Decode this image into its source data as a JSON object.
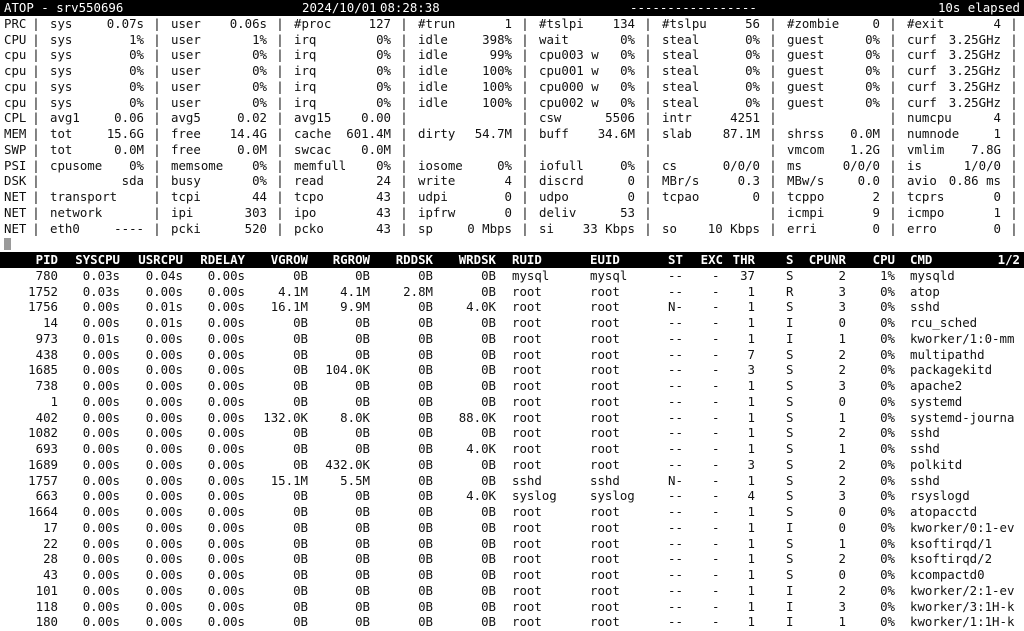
{
  "header": {
    "title": "ATOP - srv550696",
    "date": "2024/10/01",
    "time": "08:28:38",
    "dashes": "-----------------",
    "elapsed": "10s elapsed"
  },
  "system_rows": [
    {
      "label": "PRC",
      "cells": [
        [
          "sys",
          "0.07s"
        ],
        [
          "user",
          "0.06s"
        ],
        [
          "#proc",
          "127"
        ],
        [
          "#trun",
          "1"
        ],
        [
          "#tslpi",
          "134"
        ],
        [
          "#tslpu",
          "56"
        ],
        [
          "#zombie",
          "0"
        ],
        [
          "#exit",
          "4"
        ]
      ]
    },
    {
      "label": "CPU",
      "cells": [
        [
          "sys",
          "1%"
        ],
        [
          "user",
          "1%"
        ],
        [
          "irq",
          "0%"
        ],
        [
          "idle",
          "398%"
        ],
        [
          "wait",
          "0%"
        ],
        [
          "steal",
          "0%"
        ],
        [
          "guest",
          "0%"
        ],
        [
          "curf",
          "3.25GHz"
        ]
      ]
    },
    {
      "label": "cpu",
      "cells": [
        [
          "sys",
          "0%"
        ],
        [
          "user",
          "0%"
        ],
        [
          "irq",
          "0%"
        ],
        [
          "idle",
          "99%"
        ],
        [
          "cpu003 w",
          "0%"
        ],
        [
          "steal",
          "0%"
        ],
        [
          "guest",
          "0%"
        ],
        [
          "curf",
          "3.25GHz"
        ]
      ]
    },
    {
      "label": "cpu",
      "cells": [
        [
          "sys",
          "0%"
        ],
        [
          "user",
          "0%"
        ],
        [
          "irq",
          "0%"
        ],
        [
          "idle",
          "100%"
        ],
        [
          "cpu001 w",
          "0%"
        ],
        [
          "steal",
          "0%"
        ],
        [
          "guest",
          "0%"
        ],
        [
          "curf",
          "3.25GHz"
        ]
      ]
    },
    {
      "label": "cpu",
      "cells": [
        [
          "sys",
          "0%"
        ],
        [
          "user",
          "0%"
        ],
        [
          "irq",
          "0%"
        ],
        [
          "idle",
          "100%"
        ],
        [
          "cpu000 w",
          "0%"
        ],
        [
          "steal",
          "0%"
        ],
        [
          "guest",
          "0%"
        ],
        [
          "curf",
          "3.25GHz"
        ]
      ]
    },
    {
      "label": "cpu",
      "cells": [
        [
          "sys",
          "0%"
        ],
        [
          "user",
          "0%"
        ],
        [
          "irq",
          "0%"
        ],
        [
          "idle",
          "100%"
        ],
        [
          "cpu002 w",
          "0%"
        ],
        [
          "steal",
          "0%"
        ],
        [
          "guest",
          "0%"
        ],
        [
          "curf",
          "3.25GHz"
        ]
      ]
    },
    {
      "label": "CPL",
      "cells": [
        [
          "avg1",
          "0.06"
        ],
        [
          "avg5",
          "0.02"
        ],
        [
          "avg15",
          "0.00"
        ],
        [
          "",
          ""
        ],
        [
          "csw",
          "5506"
        ],
        [
          "intr",
          "4251"
        ],
        [
          "",
          ""
        ],
        [
          "numcpu",
          "4"
        ]
      ]
    },
    {
      "label": "MEM",
      "cells": [
        [
          "tot",
          "15.6G"
        ],
        [
          "free",
          "14.4G"
        ],
        [
          "cache",
          "601.4M"
        ],
        [
          "dirty",
          "54.7M"
        ],
        [
          "buff",
          "34.6M"
        ],
        [
          "slab",
          "87.1M"
        ],
        [
          "shrss",
          "0.0M"
        ],
        [
          "numnode",
          "1"
        ]
      ]
    },
    {
      "label": "SWP",
      "cells": [
        [
          "tot",
          "0.0M"
        ],
        [
          "free",
          "0.0M"
        ],
        [
          "swcac",
          "0.0M"
        ],
        [
          "",
          ""
        ],
        [
          "",
          ""
        ],
        [
          "",
          ""
        ],
        [
          "vmcom",
          "1.2G"
        ],
        [
          "vmlim",
          "7.8G"
        ]
      ]
    },
    {
      "label": "PSI",
      "cells": [
        [
          "cpusome",
          "0%"
        ],
        [
          "memsome",
          "0%"
        ],
        [
          "memfull",
          "0%"
        ],
        [
          "iosome",
          "0%"
        ],
        [
          "iofull",
          "0%"
        ],
        [
          "cs",
          "0/0/0"
        ],
        [
          "ms",
          "0/0/0"
        ],
        [
          "is",
          "1/0/0"
        ]
      ]
    },
    {
      "label": "DSK",
      "cells": [
        [
          "",
          "sda"
        ],
        [
          "busy",
          "0%"
        ],
        [
          "read",
          "24"
        ],
        [
          "write",
          "4"
        ],
        [
          "discrd",
          "0"
        ],
        [
          "MBr/s",
          "0.3"
        ],
        [
          "MBw/s",
          "0.0"
        ],
        [
          "avio",
          "0.86 ms"
        ]
      ]
    },
    {
      "label": "NET",
      "cells": [
        [
          "transport",
          ""
        ],
        [
          "tcpi",
          "44"
        ],
        [
          "tcpo",
          "43"
        ],
        [
          "udpi",
          "0"
        ],
        [
          "udpo",
          "0"
        ],
        [
          "tcpao",
          "0"
        ],
        [
          "tcppo",
          "2"
        ],
        [
          "tcprs",
          "0"
        ]
      ]
    },
    {
      "label": "NET",
      "cells": [
        [
          "network",
          ""
        ],
        [
          "ipi",
          "303"
        ],
        [
          "ipo",
          "43"
        ],
        [
          "ipfrw",
          "0"
        ],
        [
          "deliv",
          "53"
        ],
        [
          "",
          ""
        ],
        [
          "icmpi",
          "9"
        ],
        [
          "icmpo",
          "1"
        ]
      ]
    },
    {
      "label": "NET",
      "cells": [
        [
          "eth0",
          "----"
        ],
        [
          "pcki",
          "520"
        ],
        [
          "pcko",
          "43"
        ],
        [
          "sp",
          "0 Mbps"
        ],
        [
          "si",
          "33 Kbps"
        ],
        [
          "so",
          "10 Kbps"
        ],
        [
          "erri",
          "0"
        ],
        [
          "erro",
          "0"
        ]
      ]
    }
  ],
  "process_table": {
    "columns": [
      "PID",
      "SYSCPU",
      "USRCPU",
      "RDELAY",
      "VGROW",
      "RGROW",
      "RDDSK",
      "WRDSK",
      "RUID",
      "EUID",
      "ST",
      "EXC",
      "THR",
      "S",
      "CPUNR",
      "CPU",
      "CMD"
    ],
    "page": "1/2",
    "rows": [
      [
        "780",
        "0.03s",
        "0.04s",
        "0.00s",
        "0B",
        "0B",
        "0B",
        "0B",
        "mysql",
        "mysql",
        "--",
        "-",
        "37",
        "S",
        "2",
        "1%",
        "mysqld"
      ],
      [
        "1752",
        "0.03s",
        "0.00s",
        "0.00s",
        "4.1M",
        "4.1M",
        "2.8M",
        "0B",
        "root",
        "root",
        "--",
        "-",
        "1",
        "R",
        "3",
        "0%",
        "atop"
      ],
      [
        "1756",
        "0.00s",
        "0.01s",
        "0.00s",
        "16.1M",
        "9.9M",
        "0B",
        "4.0K",
        "root",
        "root",
        "N-",
        "-",
        "1",
        "S",
        "3",
        "0%",
        "sshd"
      ],
      [
        "14",
        "0.00s",
        "0.01s",
        "0.00s",
        "0B",
        "0B",
        "0B",
        "0B",
        "root",
        "root",
        "--",
        "-",
        "1",
        "I",
        "0",
        "0%",
        "rcu_sched"
      ],
      [
        "973",
        "0.01s",
        "0.00s",
        "0.00s",
        "0B",
        "0B",
        "0B",
        "0B",
        "root",
        "root",
        "--",
        "-",
        "1",
        "I",
        "1",
        "0%",
        "kworker/1:0-mm"
      ],
      [
        "438",
        "0.00s",
        "0.00s",
        "0.00s",
        "0B",
        "0B",
        "0B",
        "0B",
        "root",
        "root",
        "--",
        "-",
        "7",
        "S",
        "2",
        "0%",
        "multipathd"
      ],
      [
        "1685",
        "0.00s",
        "0.00s",
        "0.00s",
        "0B",
        "104.0K",
        "0B",
        "0B",
        "root",
        "root",
        "--",
        "-",
        "3",
        "S",
        "2",
        "0%",
        "packagekitd"
      ],
      [
        "738",
        "0.00s",
        "0.00s",
        "0.00s",
        "0B",
        "0B",
        "0B",
        "0B",
        "root",
        "root",
        "--",
        "-",
        "1",
        "S",
        "3",
        "0%",
        "apache2"
      ],
      [
        "1",
        "0.00s",
        "0.00s",
        "0.00s",
        "0B",
        "0B",
        "0B",
        "0B",
        "root",
        "root",
        "--",
        "-",
        "1",
        "S",
        "0",
        "0%",
        "systemd"
      ],
      [
        "402",
        "0.00s",
        "0.00s",
        "0.00s",
        "132.0K",
        "8.0K",
        "0B",
        "88.0K",
        "root",
        "root",
        "--",
        "-",
        "1",
        "S",
        "1",
        "0%",
        "systemd-journa"
      ],
      [
        "1082",
        "0.00s",
        "0.00s",
        "0.00s",
        "0B",
        "0B",
        "0B",
        "0B",
        "root",
        "root",
        "--",
        "-",
        "1",
        "S",
        "2",
        "0%",
        "sshd"
      ],
      [
        "693",
        "0.00s",
        "0.00s",
        "0.00s",
        "0B",
        "0B",
        "0B",
        "4.0K",
        "root",
        "root",
        "--",
        "-",
        "1",
        "S",
        "1",
        "0%",
        "sshd"
      ],
      [
        "1689",
        "0.00s",
        "0.00s",
        "0.00s",
        "0B",
        "432.0K",
        "0B",
        "0B",
        "root",
        "root",
        "--",
        "-",
        "3",
        "S",
        "2",
        "0%",
        "polkitd"
      ],
      [
        "1757",
        "0.00s",
        "0.00s",
        "0.00s",
        "15.1M",
        "5.5M",
        "0B",
        "0B",
        "sshd",
        "sshd",
        "N-",
        "-",
        "1",
        "S",
        "2",
        "0%",
        "sshd"
      ],
      [
        "663",
        "0.00s",
        "0.00s",
        "0.00s",
        "0B",
        "0B",
        "0B",
        "4.0K",
        "syslog",
        "syslog",
        "--",
        "-",
        "4",
        "S",
        "3",
        "0%",
        "rsyslogd"
      ],
      [
        "1664",
        "0.00s",
        "0.00s",
        "0.00s",
        "0B",
        "0B",
        "0B",
        "0B",
        "root",
        "root",
        "--",
        "-",
        "1",
        "S",
        "0",
        "0%",
        "atopacctd"
      ],
      [
        "17",
        "0.00s",
        "0.00s",
        "0.00s",
        "0B",
        "0B",
        "0B",
        "0B",
        "root",
        "root",
        "--",
        "-",
        "1",
        "I",
        "0",
        "0%",
        "kworker/0:1-ev"
      ],
      [
        "22",
        "0.00s",
        "0.00s",
        "0.00s",
        "0B",
        "0B",
        "0B",
        "0B",
        "root",
        "root",
        "--",
        "-",
        "1",
        "S",
        "1",
        "0%",
        "ksoftirqd/1"
      ],
      [
        "28",
        "0.00s",
        "0.00s",
        "0.00s",
        "0B",
        "0B",
        "0B",
        "0B",
        "root",
        "root",
        "--",
        "-",
        "1",
        "S",
        "2",
        "0%",
        "ksoftirqd/2"
      ],
      [
        "43",
        "0.00s",
        "0.00s",
        "0.00s",
        "0B",
        "0B",
        "0B",
        "0B",
        "root",
        "root",
        "--",
        "-",
        "1",
        "S",
        "0",
        "0%",
        "kcompactd0"
      ],
      [
        "101",
        "0.00s",
        "0.00s",
        "0.00s",
        "0B",
        "0B",
        "0B",
        "0B",
        "root",
        "root",
        "--",
        "-",
        "1",
        "I",
        "2",
        "0%",
        "kworker/2:1-ev"
      ],
      [
        "118",
        "0.00s",
        "0.00s",
        "0.00s",
        "0B",
        "0B",
        "0B",
        "0B",
        "root",
        "root",
        "--",
        "-",
        "1",
        "I",
        "3",
        "0%",
        "kworker/3:1H-k"
      ],
      [
        "180",
        "0.00s",
        "0.00s",
        "0.00s",
        "0B",
        "0B",
        "0B",
        "0B",
        "root",
        "root",
        "--",
        "-",
        "1",
        "I",
        "1",
        "0%",
        "kworker/1:1H-k"
      ]
    ]
  }
}
